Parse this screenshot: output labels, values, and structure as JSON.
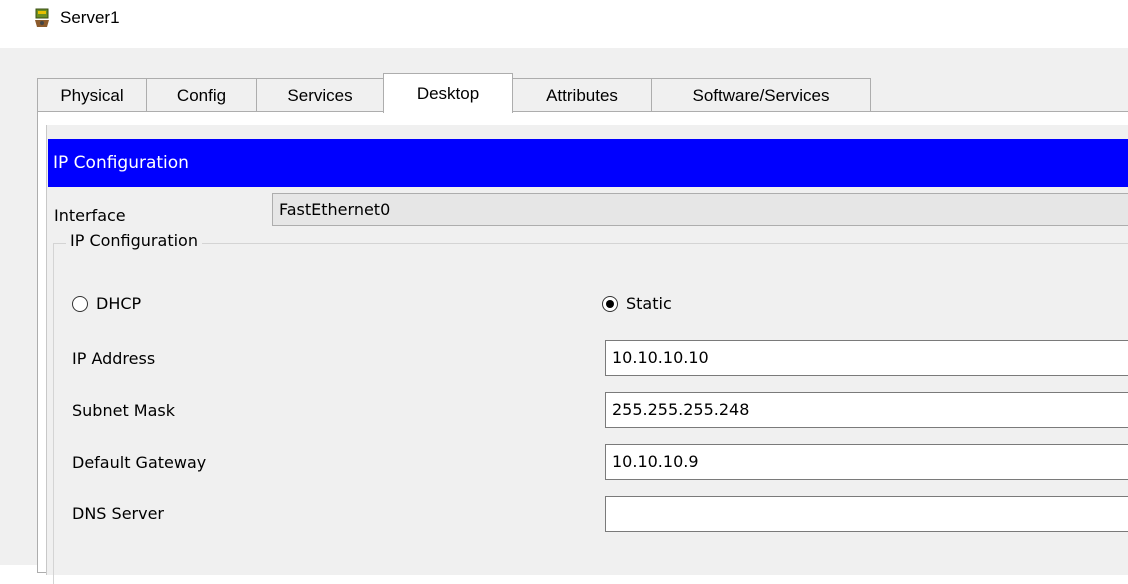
{
  "window": {
    "title": "Server1",
    "icon": "server-icon"
  },
  "tabs": [
    {
      "label": "Physical",
      "active": false
    },
    {
      "label": "Config",
      "active": false
    },
    {
      "label": "Services",
      "active": false
    },
    {
      "label": "Desktop",
      "active": true
    },
    {
      "label": "Attributes",
      "active": false
    },
    {
      "label": "Software/Services",
      "active": false
    }
  ],
  "ip_config": {
    "header": "IP Configuration",
    "interface_label": "Interface",
    "interface_value": "FastEthernet0",
    "group_title": "IP Configuration",
    "dhcp_label": "DHCP",
    "static_label": "Static",
    "mode": "Static",
    "fields": {
      "ip_address": {
        "label": "IP Address",
        "value": "10.10.10.10"
      },
      "subnet_mask": {
        "label": "Subnet Mask",
        "value": "255.255.255.248"
      },
      "default_gateway": {
        "label": "Default Gateway",
        "value": "10.10.10.9"
      },
      "dns_server": {
        "label": "DNS Server",
        "value": ""
      }
    }
  },
  "colors": {
    "header_bg": "#0000ff",
    "header_text": "#ffffff",
    "window_bg": "#f0f0f0"
  }
}
